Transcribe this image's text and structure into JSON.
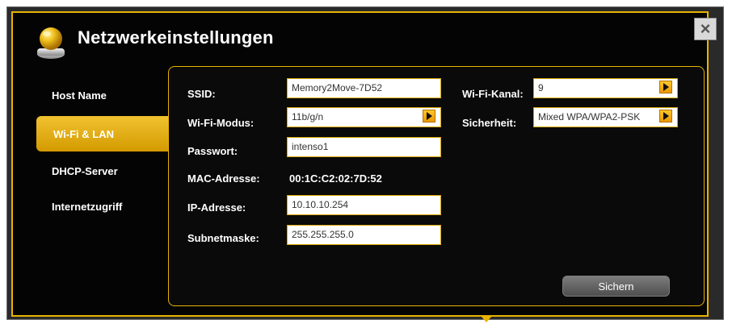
{
  "app": {
    "title": "Netzwerkeinstellungen"
  },
  "sidebar": {
    "items": [
      {
        "label": "Host Name",
        "active": false
      },
      {
        "label": "Wi-Fi & LAN",
        "active": true
      },
      {
        "label": "DHCP-Server",
        "active": false
      },
      {
        "label": "Internetzugriff",
        "active": false
      }
    ]
  },
  "form": {
    "ssid": {
      "label": "SSID:",
      "value": "Memory2Move-7D52"
    },
    "wifi_mode": {
      "label": "Wi-Fi-Modus:",
      "value": "11b/g/n"
    },
    "password": {
      "label": "Passwort:",
      "value": "intenso1"
    },
    "mac": {
      "label": "MAC-Adresse:",
      "value": "00:1C:C2:02:7D:52"
    },
    "ip": {
      "label": "IP-Adresse:",
      "value": "10.10.10.254"
    },
    "subnet": {
      "label": "Subnetmaske:",
      "value": "255.255.255.0"
    },
    "wifi_channel": {
      "label": "Wi-Fi-Kanal:",
      "value": "9"
    },
    "security": {
      "label": "Sicherheit:",
      "value": "Mixed WPA/WPA2-PSK"
    }
  },
  "actions": {
    "save_label": "Sichern"
  },
  "icons": {
    "app": "network-settings-icon",
    "close": "close-icon",
    "dropdown": "chevron-right-icon"
  },
  "colors": {
    "accent": "#e9b300",
    "background": "#040404"
  }
}
